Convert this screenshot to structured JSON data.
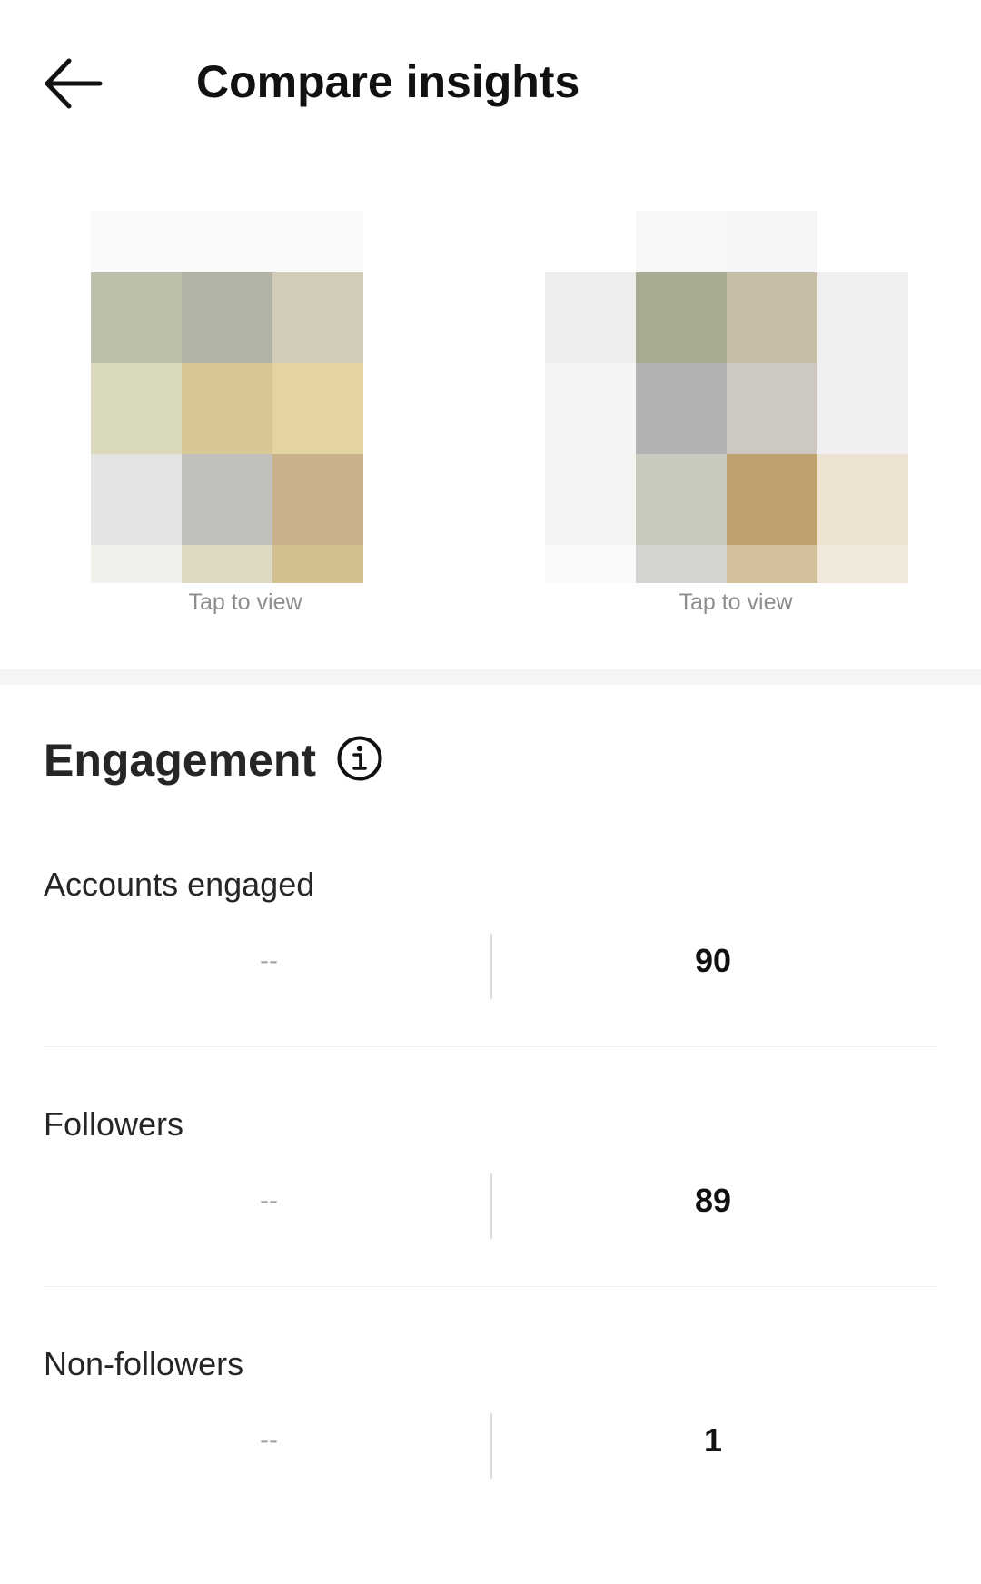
{
  "header": {
    "title": "Compare insights",
    "back_icon": "arrow-left-icon"
  },
  "previews": [
    {
      "label": "Tap to view"
    },
    {
      "label": "Tap to view"
    }
  ],
  "engagement": {
    "title": "Engagement",
    "info_icon": "info-icon",
    "metrics": [
      {
        "label": "Accounts engaged",
        "left_value": "--",
        "right_value": "90"
      },
      {
        "label": "Followers",
        "left_value": "--",
        "right_value": "89"
      },
      {
        "label": "Non-followers",
        "left_value": "--",
        "right_value": "1"
      }
    ]
  }
}
